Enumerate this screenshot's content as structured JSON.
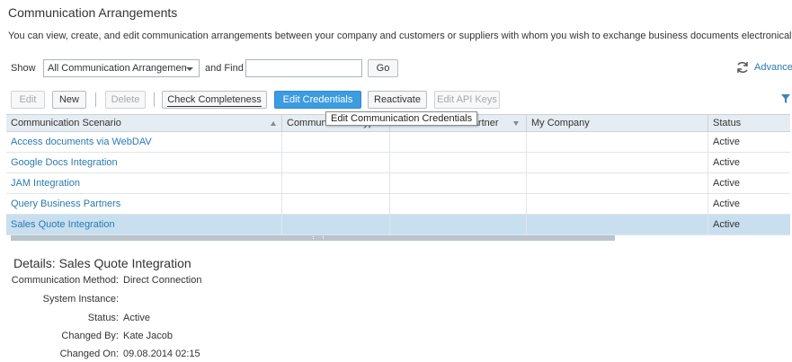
{
  "header": {
    "title": "Communication Arrangements",
    "description": "You can view, create, and edit communication arrangements between your company and customers or suppliers with whom you wish to exchange business documents electronically."
  },
  "filter": {
    "show_label": "Show",
    "show_value": "All Communication Arrangemen",
    "find_label": "and Find",
    "find_value": "",
    "go_label": "Go",
    "advanced_label": "Advanced"
  },
  "toolbar": {
    "edit": "Edit",
    "new": "New",
    "delete": "Delete",
    "check": "Check Completeness",
    "edit_credentials": "Edit Credentials",
    "reactivate": "Reactivate",
    "edit_api_keys": "Edit API Keys"
  },
  "tooltip": "Edit Communication Credentials",
  "table": {
    "columns": [
      "Communication Scenario",
      "Communication Type",
      "Communication Partner",
      "My Company",
      "Status"
    ],
    "rows": [
      {
        "scenario": "Access documents via WebDAV",
        "type": "",
        "partner": "",
        "company": "",
        "status": "Active"
      },
      {
        "scenario": "Google Docs Integration",
        "type": "",
        "partner": "",
        "company": "",
        "status": "Active"
      },
      {
        "scenario": "JAM Integration",
        "type": "",
        "partner": "",
        "company": "",
        "status": "Active"
      },
      {
        "scenario": "Query Business Partners",
        "type": "",
        "partner": "",
        "company": "",
        "status": "Active"
      },
      {
        "scenario": "Sales Quote Integration",
        "type": "",
        "partner": "",
        "company": "",
        "status": "Active"
      }
    ],
    "selected_row": 4
  },
  "details": {
    "title": "Details: Sales Quote Integration",
    "method_label": "Communication Method:",
    "method_value": "Direct Connection",
    "system_label": "System Instance:",
    "system_value": "",
    "status_label": "Status:",
    "status_value": "Active",
    "changed_by_label": "Changed By:",
    "changed_by_value": "Kate Jacob",
    "changed_on_label": "Changed On:",
    "changed_on_value": "09.08.2014 02:15"
  },
  "colors": {
    "link": "#2a7ab0",
    "primary_button": "#3d9be0",
    "selected_row": "#c8dff0",
    "header_bg": "#e5ecf2"
  },
  "icons": {
    "refresh": "refresh-icon",
    "filter": "filter-icon",
    "sort": "sort-ascending-icon",
    "column_filter": "column-filter-icon"
  }
}
